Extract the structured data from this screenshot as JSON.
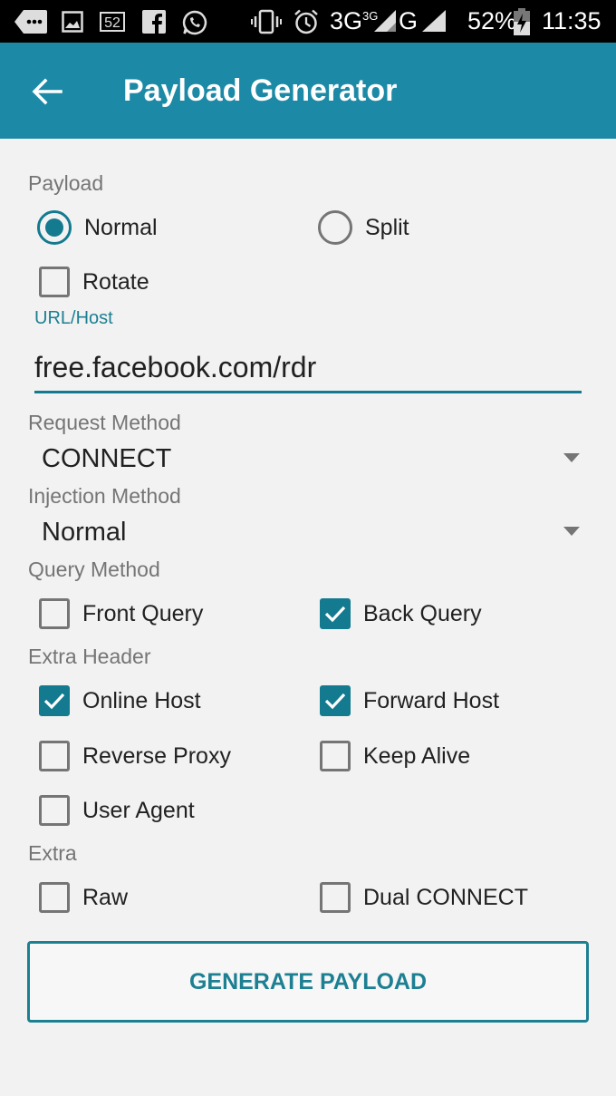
{
  "status_bar": {
    "icons": [
      "more-notifications-icon",
      "image-icon",
      "calendar-52-icon",
      "facebook-icon",
      "whatsapp-icon",
      "vibrate-icon",
      "alarm-icon",
      "signal-3g-icon",
      "signal-g-icon",
      "battery-charging-icon"
    ],
    "network_1": "3G",
    "network_1_sup": "3G",
    "network_2": "G",
    "calendar_badge": "52",
    "battery": "52%",
    "time": "11:35"
  },
  "app_bar": {
    "title": "Payload Generator",
    "color": "#1c8aa6"
  },
  "payload": {
    "label": "Payload",
    "options": [
      {
        "label": "Normal",
        "selected": true
      },
      {
        "label": "Split",
        "selected": false
      }
    ],
    "rotate": {
      "label": "Rotate",
      "checked": false
    }
  },
  "url_host": {
    "label": "URL/Host",
    "value": "free.facebook.com/rdr"
  },
  "request_method": {
    "label": "Request Method",
    "value": "CONNECT"
  },
  "injection_method": {
    "label": "Injection Method",
    "value": "Normal"
  },
  "query_method": {
    "label": "Query Method",
    "options": [
      {
        "label": "Front Query",
        "checked": false
      },
      {
        "label": "Back Query",
        "checked": true
      }
    ]
  },
  "extra_header": {
    "label": "Extra Header",
    "options": [
      {
        "label": "Online Host",
        "checked": true
      },
      {
        "label": "Forward Host",
        "checked": true
      },
      {
        "label": "Reverse Proxy",
        "checked": false
      },
      {
        "label": "Keep Alive",
        "checked": false
      },
      {
        "label": "User Agent",
        "checked": false
      }
    ]
  },
  "extra": {
    "label": "Extra",
    "options": [
      {
        "label": "Raw",
        "checked": false
      },
      {
        "label": "Dual CONNECT",
        "checked": false
      }
    ]
  },
  "generate_button": {
    "label": "GENERATE PAYLOAD"
  },
  "accent_color": "#137a8f"
}
